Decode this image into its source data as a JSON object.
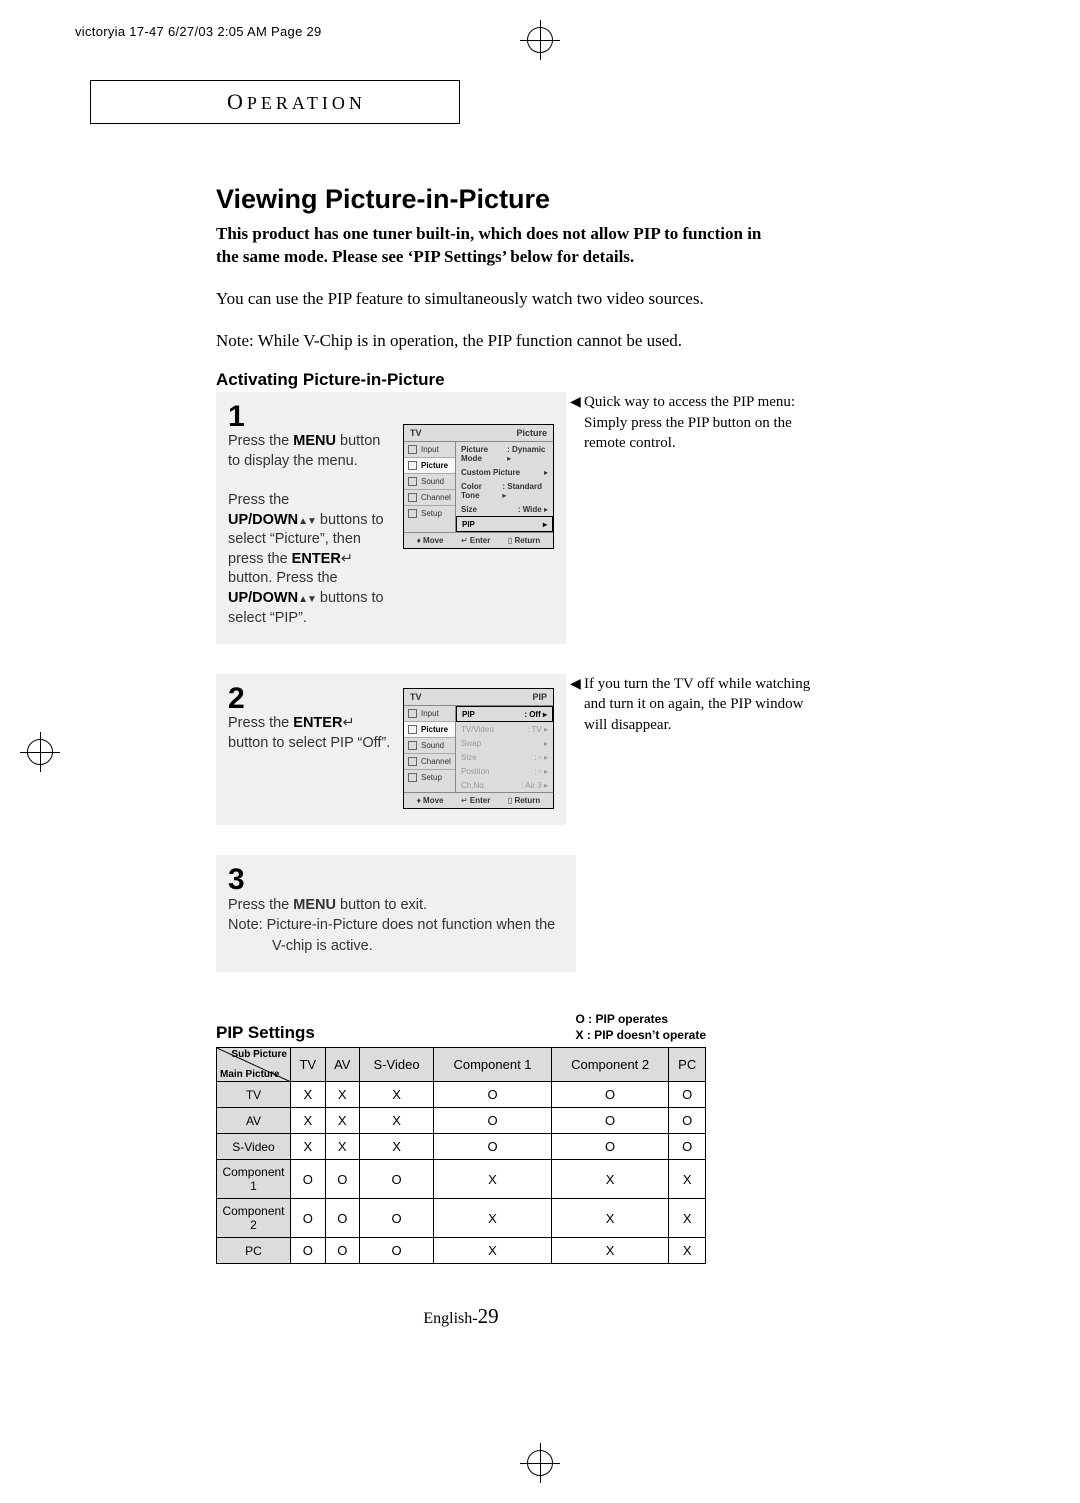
{
  "slug": "victoryia 17-47  6/27/03 2:05 AM  Page 29",
  "section_label_cap": "O",
  "section_label_rest": "PERATION",
  "title": "Viewing Picture-in-Picture",
  "intro_bold": "This product has one tuner built-in, which does not allow PIP to function in the same mode. Please see ‘PIP Settings’ below for details.",
  "intro1": "You can use the PIP feature to simultaneously watch two video sources.",
  "intro2": "Note:  While V-Chip is in operation, the PIP function cannot be used.",
  "activating_heading": "Activating Picture-in-Picture",
  "steps": {
    "s1": {
      "num": "1",
      "l1a": "Press the ",
      "l1b": "MENU",
      "l1c": " button to display the menu.",
      "l2a": "Press the",
      "l2b": "UP/DOWN",
      "l2arr": "▲▼",
      "l2c": " buttons to select “Picture”, then press the ",
      "l2d": "ENTER",
      "l2icon": "↵",
      "l2e": " button. Press the ",
      "l2f": "UP/DOWN",
      "l2arr2": "▲▼",
      "l2g": " buttons to select “PIP”."
    },
    "s2": {
      "num": "2",
      "a": "Press the ",
      "b": "ENTER",
      "icon": "↵",
      "c": " button to select PIP “Off”."
    },
    "s3": {
      "num": "3",
      "a": "Press the ",
      "b": "MENU",
      "c": " button to exit.",
      "note1": "Note: Picture-in-Picture does not function when the",
      "note2": "V-chip is active."
    }
  },
  "side1": "Quick way to access the PIP menu: Simply press the PIP button on the remote control.",
  "side2": "If you turn the TV off while watching and turn it on again, the PIP window will disappear.",
  "osd1": {
    "hl": "TV",
    "hr": "Picture",
    "side": [
      "Input",
      "Picture",
      "Sound",
      "Channel",
      "Setup"
    ],
    "side_sel": 1,
    "rows": [
      {
        "k": "Picture Mode",
        "v": ": Dynamic",
        "a": "▸"
      },
      {
        "k": "Custom Picture",
        "v": "",
        "a": "▸"
      },
      {
        "k": "Color Tone",
        "v": ": Standard",
        "a": "▸"
      },
      {
        "k": "Size",
        "v": ": Wide",
        "a": "▸"
      },
      {
        "k": "PIP",
        "v": "",
        "a": "▸",
        "sel": true
      }
    ],
    "f1": "Move",
    "f2": "Enter",
    "f3": "Return"
  },
  "osd2": {
    "hl": "TV",
    "hr": "PIP",
    "side": [
      "Input",
      "Picture",
      "Sound",
      "Channel",
      "Setup"
    ],
    "side_sel": 1,
    "rows": [
      {
        "k": "PIP",
        "v": ": Off",
        "a": "▸",
        "sel": true
      },
      {
        "k": "TV/Video",
        "v": ": TV",
        "a": "▸",
        "dim": true
      },
      {
        "k": "Swap",
        "v": "",
        "a": "▸",
        "dim": true
      },
      {
        "k": "Size",
        "v": ": ▫",
        "a": "▸",
        "dim": true
      },
      {
        "k": "Position",
        "v": ": ▫",
        "a": "▸",
        "dim": true
      },
      {
        "k": "Ch.No.",
        "v": ": Air    3",
        "a": "▸",
        "dim": true
      }
    ],
    "f1": "Move",
    "f2": "Enter",
    "f3": "Return"
  },
  "pip_heading": "PIP Settings",
  "pip_legend1": "O : PIP operates",
  "pip_legend2": "X : PIP doesn’t operate",
  "pip_corner_sub": "Sub Picture",
  "pip_corner_main": "Main Picture",
  "pip_cols": [
    "TV",
    "AV",
    "S-Video",
    "Component 1",
    "Component 2",
    "PC"
  ],
  "pip_rows": [
    "TV",
    "AV",
    "S-Video",
    "Component 1",
    "Component 2",
    "PC"
  ],
  "pip_data": [
    [
      "X",
      "X",
      "X",
      "O",
      "O",
      "O"
    ],
    [
      "X",
      "X",
      "X",
      "O",
      "O",
      "O"
    ],
    [
      "X",
      "X",
      "X",
      "O",
      "O",
      "O"
    ],
    [
      "O",
      "O",
      "O",
      "X",
      "X",
      "X"
    ],
    [
      "O",
      "O",
      "O",
      "X",
      "X",
      "X"
    ],
    [
      "O",
      "O",
      "O",
      "X",
      "X",
      "X"
    ]
  ],
  "foot_lang": "English-",
  "foot_page": "29"
}
